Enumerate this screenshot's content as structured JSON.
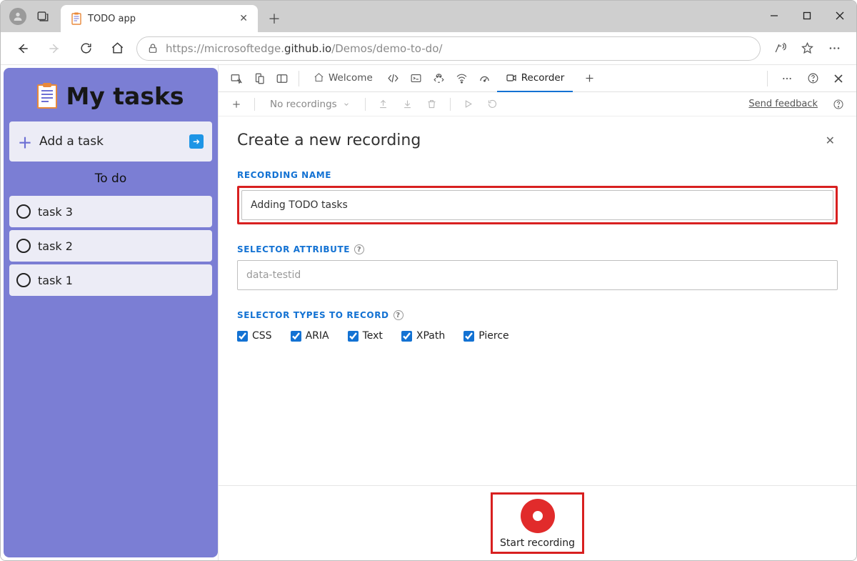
{
  "browser": {
    "tab_title": "TODO app",
    "url_prefix": "https://",
    "url_host_dim1": "microsoftedge.",
    "url_host_dark": "github.io",
    "url_path_dim": "/Demos/demo-to-do/"
  },
  "todo": {
    "title": "My tasks",
    "add_label": "Add a task",
    "section": "To do",
    "tasks": [
      "task 3",
      "task 2",
      "task 1"
    ]
  },
  "devtools": {
    "tabs": {
      "welcome": "Welcome",
      "recorder": "Recorder"
    },
    "no_recordings": "No recordings",
    "send_feedback": "Send feedback"
  },
  "recorder": {
    "heading": "Create a new recording",
    "name_label": "RECORDING NAME",
    "name_value": "Adding TODO tasks",
    "selector_attr_label": "SELECTOR ATTRIBUTE",
    "selector_attr_placeholder": "data-testid",
    "types_label": "SELECTOR TYPES TO RECORD",
    "types": {
      "css": "CSS",
      "aria": "ARIA",
      "text": "Text",
      "xpath": "XPath",
      "pierce": "Pierce"
    },
    "start_label": "Start recording"
  }
}
